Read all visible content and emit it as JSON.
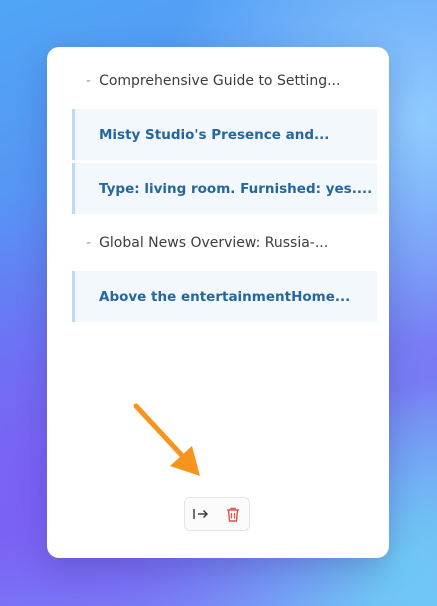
{
  "panel": {
    "items": [
      {
        "kind": "plain",
        "text": "Comprehensive Guide to Setting..."
      },
      {
        "kind": "highlight",
        "text": "Misty Studio's Presence and..."
      },
      {
        "kind": "highlight",
        "text": "Type: living room. Furnished: yes...."
      },
      {
        "kind": "plain",
        "text": "Global News Overview: Russia-..."
      },
      {
        "kind": "highlight",
        "text": "Above the entertainmentHome..."
      }
    ],
    "dash": "-"
  },
  "toolbar": {
    "collapse_icon": "collapse-right-icon",
    "delete_icon": "trash-icon"
  },
  "colors": {
    "highlight_text": "#2467a0",
    "highlight_bg": "#f2f8fc",
    "highlight_border": "#b9dcf3",
    "delete": "#e0524a",
    "annotation_arrow": "#f7941d"
  }
}
